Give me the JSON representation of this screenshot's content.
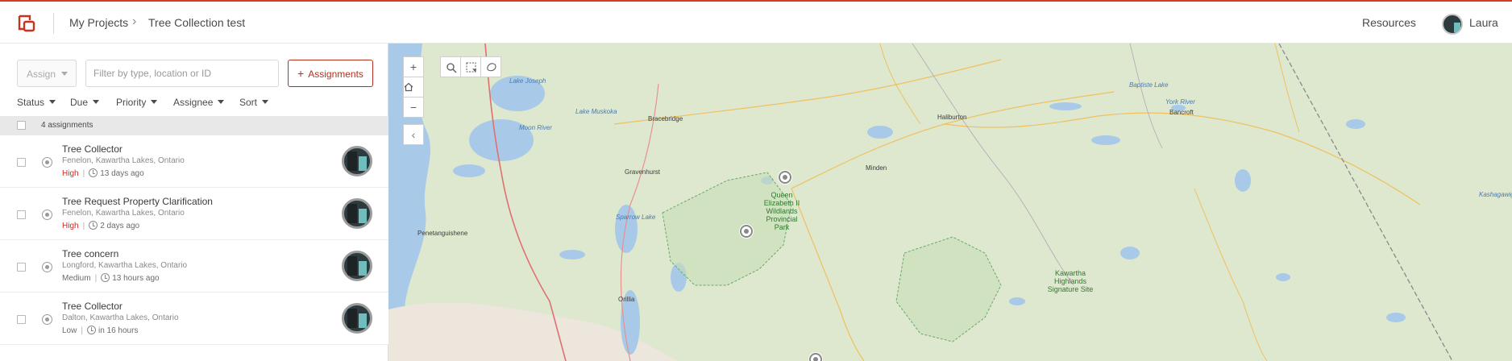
{
  "header": {
    "breadcrumb_root": "My Projects",
    "breadcrumb_current": "Tree Collection test",
    "resources_label": "Resources",
    "user_name": "Laura"
  },
  "toolbar": {
    "assign_label": "Assign",
    "filter_placeholder": "Filter by type, location or ID",
    "add_assignments_label": "Assignments"
  },
  "filters": [
    {
      "label": "Status"
    },
    {
      "label": "Due"
    },
    {
      "label": "Priority"
    },
    {
      "label": "Assignee"
    },
    {
      "label": "Sort"
    }
  ],
  "list": {
    "count_label": "4 assignments",
    "items": [
      {
        "title": "Tree Collector",
        "location": "Fenelon, Kawartha Lakes, Ontario",
        "priority": "High",
        "time": "13 days ago"
      },
      {
        "title": "Tree Request Property Clarification",
        "location": "Fenelon, Kawartha Lakes, Ontario",
        "priority": "High",
        "time": "2 days ago"
      },
      {
        "title": "Tree concern",
        "location": "Longford, Kawartha Lakes, Ontario",
        "priority": "Medium",
        "time": "13 hours ago"
      },
      {
        "title": "Tree Collector",
        "location": "Dalton, Kawartha Lakes, Ontario",
        "priority": "Low",
        "time": "in 16 hours"
      }
    ]
  },
  "map": {
    "zoom_in": "+",
    "zoom_out": "−",
    "collapse": "‹",
    "labels": {
      "lake_joseph": "Lake Joseph",
      "lake_muskoka": "Lake Muskoka",
      "bracebridge": "Bracebridge",
      "moon_river": "Moon River",
      "gravenhurst": "Gravenhurst",
      "sparrow_lake": "Sparrow Lake",
      "penetanguishene": "Penetanguishene",
      "orillia": "Orillia",
      "minden": "Minden",
      "haliburton": "Haliburton",
      "baptiste_lake": "Baptiste Lake",
      "york_river": "York River",
      "bancroft": "Bancroft",
      "kashagawigamog": "Kashagawigamog",
      "qe2_park": "Queen Elizabeth II Wildlands Provincial Park",
      "kawartha_park": "Kawartha Highlands Signature Site"
    }
  },
  "colors": {
    "brand": "#b5301f",
    "priority_high": "#d0281e",
    "map_land": "#dde8cf",
    "map_water": "#a9c9e8"
  },
  "icons": {
    "logo": "logo-icon",
    "search": "search-icon",
    "select": "select-icon",
    "lasso": "lasso-icon",
    "home": "home-icon",
    "clock": "clock-icon",
    "status": "status-icon"
  }
}
